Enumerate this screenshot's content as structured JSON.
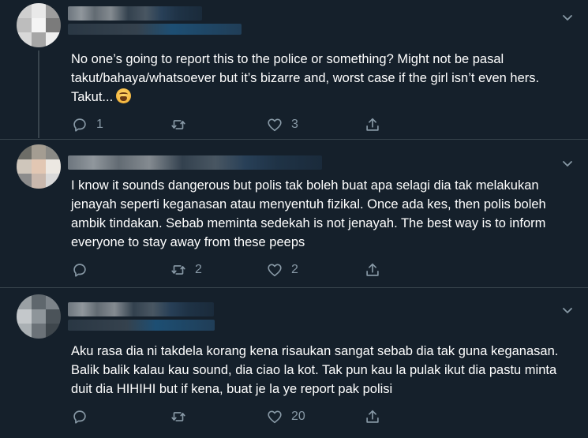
{
  "tweets": [
    {
      "text": "No one’s going to report this to the police or something? Might not be pasal takut/bahaya/whatsoever but it’s bizarre and, worst case if the girl isn’t even hers. Takut...",
      "emoji_icon": "weary-face-emoji",
      "reply_count": "1",
      "retweet_count": "",
      "like_count": "3",
      "avatar_colors": [
        "#cfcfcf",
        "#e9e9e9",
        "#9d9d9d",
        "#bdbdbd",
        "#f4f4f4",
        "#7b7b7b",
        "#d8d8d8",
        "#a6a6a6",
        "#efefef"
      ]
    },
    {
      "text": "I know it sounds dangerous but polis tak boleh buat apa selagi dia tak melakukan jenayah seperti keganasan atau menyentuh fizikal. Once ada kes, then polis boleh ambik tindakan. Sebab meminta sedekah is not jenayah. The best way is to inform everyone to stay away from these peeps",
      "reply_count": "",
      "retweet_count": "2",
      "like_count": "2",
      "avatar_colors": [
        "#6d6d67",
        "#a49d92",
        "#8a8a86",
        "#cfc6bb",
        "#e2c7b3",
        "#ece8e2",
        "#8c8c8c",
        "#c9b8ad",
        "#d9d9d9"
      ]
    },
    {
      "text": "Aku rasa dia ni takdela korang kena risaukan sangat sebab dia tak guna keganasan. Balik balik kalau kau sound, dia ciao la kot. Tak pun kau la pulak ikut dia pastu minta duit dia HIHIHI but if kena, buat je la ye report pak polisi",
      "reply_count": "",
      "retweet_count": "",
      "like_count": "20",
      "avatar_colors": [
        "#9aa0a4",
        "#5f676d",
        "#7c8389",
        "#c4c8cb",
        "#8e959a",
        "#4b5359",
        "#aab0b4",
        "#6b7278",
        "#3e464c"
      ]
    }
  ],
  "icons": {
    "reply": "reply-icon",
    "retweet": "retweet-icon",
    "like": "heart-icon",
    "share": "share-icon",
    "more": "chevron-down-icon"
  },
  "colors": {
    "background": "#15202b",
    "divider": "#38444d",
    "action_gray": "#8899a6",
    "text": "#ffffff"
  }
}
